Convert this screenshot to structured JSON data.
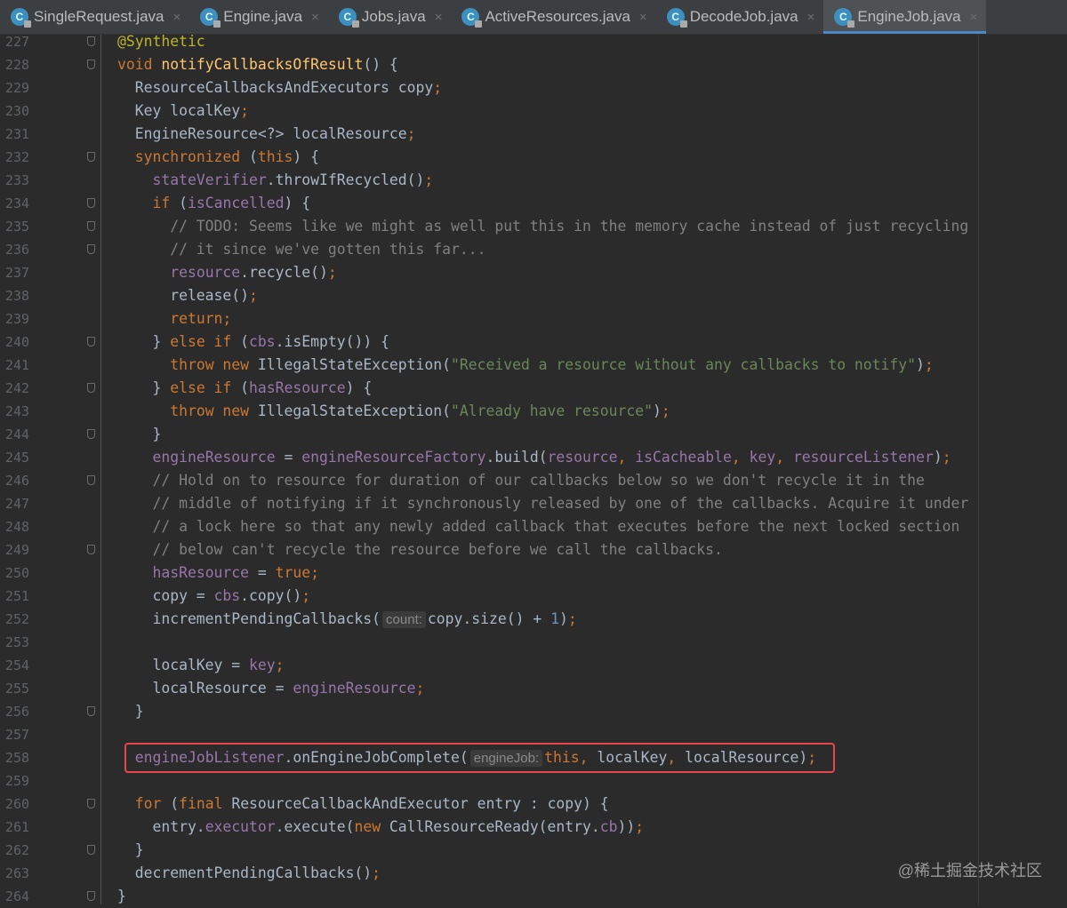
{
  "tabs": [
    {
      "label": "SingleRequest.java",
      "icon": "C",
      "active": false
    },
    {
      "label": "Engine.java",
      "icon": "C",
      "active": false
    },
    {
      "label": "Jobs.java",
      "icon": "C",
      "active": false
    },
    {
      "label": "ActiveResources.java",
      "icon": "C",
      "active": false
    },
    {
      "label": "DecodeJob.java",
      "icon": "C",
      "active": false
    },
    {
      "label": "EngineJob.java",
      "icon": "C",
      "active": true
    }
  ],
  "close_glyph": "×",
  "watermark": "@稀土掘金技术社区",
  "highlight_line": "258",
  "colors": {
    "keyword": "#cc7832",
    "field": "#9876aa",
    "method": "#ffc66d",
    "string": "#6a8759",
    "comment": "#808080",
    "number": "#6897bb",
    "annotation": "#bbb529",
    "highlight": "#e5484d"
  },
  "lines": [
    {
      "n": "227",
      "fold": true,
      "t": [
        [
          "@Synthetic",
          "a"
        ]
      ]
    },
    {
      "n": "228",
      "fold": true,
      "t": [
        [
          "void",
          "k"
        ],
        [
          " ",
          ""
        ],
        [
          "notifyCallbacksOfResult",
          "m"
        ],
        [
          "() {",
          ""
        ]
      ]
    },
    {
      "n": "229",
      "t": [
        [
          "  ResourceCallbacksAndExecutors copy",
          ""
        ],
        [
          ";",
          "k"
        ]
      ]
    },
    {
      "n": "230",
      "t": [
        [
          "  Key localKey",
          ""
        ],
        [
          ";",
          "k"
        ]
      ]
    },
    {
      "n": "231",
      "t": [
        [
          "  EngineResource<?> localResource",
          ""
        ],
        [
          ";",
          "k"
        ]
      ]
    },
    {
      "n": "232",
      "fold": true,
      "t": [
        [
          "  ",
          ""
        ],
        [
          "synchronized",
          "k"
        ],
        [
          " (",
          ""
        ],
        [
          "this",
          "k"
        ],
        [
          ") {",
          ""
        ]
      ]
    },
    {
      "n": "233",
      "t": [
        [
          "    ",
          ""
        ],
        [
          "stateVerifier",
          "f"
        ],
        [
          ".throwIfRecycled()",
          ""
        ],
        [
          ";",
          "k"
        ]
      ]
    },
    {
      "n": "234",
      "fold": true,
      "t": [
        [
          "    ",
          ""
        ],
        [
          "if",
          "k"
        ],
        [
          " (",
          ""
        ],
        [
          "isCancelled",
          "f"
        ],
        [
          ") {",
          ""
        ]
      ]
    },
    {
      "n": "235",
      "fold": true,
      "t": [
        [
          "      // TODO: Seems like we might as well put this in the memory cache instead of just recycling",
          "c"
        ]
      ]
    },
    {
      "n": "236",
      "fold": true,
      "t": [
        [
          "      // it since we've gotten this far...",
          "c"
        ]
      ]
    },
    {
      "n": "237",
      "t": [
        [
          "      ",
          ""
        ],
        [
          "resource",
          "f"
        ],
        [
          ".recycle()",
          ""
        ],
        [
          ";",
          "k"
        ]
      ]
    },
    {
      "n": "238",
      "t": [
        [
          "      release()",
          ""
        ],
        [
          ";",
          "k"
        ]
      ]
    },
    {
      "n": "239",
      "t": [
        [
          "      ",
          ""
        ],
        [
          "return;",
          "k"
        ]
      ]
    },
    {
      "n": "240",
      "fold": true,
      "t": [
        [
          "    } ",
          ""
        ],
        [
          "else if",
          "k"
        ],
        [
          " (",
          ""
        ],
        [
          "cbs",
          "f"
        ],
        [
          ".isEmpty()) {",
          ""
        ]
      ]
    },
    {
      "n": "241",
      "t": [
        [
          "      ",
          ""
        ],
        [
          "throw new",
          "k"
        ],
        [
          " IllegalStateException(",
          ""
        ],
        [
          "\"Received a resource without any callbacks to notify\"",
          "s"
        ],
        [
          ")",
          ""
        ],
        [
          ";",
          "k"
        ]
      ]
    },
    {
      "n": "242",
      "fold": true,
      "t": [
        [
          "    } ",
          ""
        ],
        [
          "else if",
          "k"
        ],
        [
          " (",
          ""
        ],
        [
          "hasResource",
          "f"
        ],
        [
          ") {",
          ""
        ]
      ]
    },
    {
      "n": "243",
      "t": [
        [
          "      ",
          ""
        ],
        [
          "throw new",
          "k"
        ],
        [
          " IllegalStateException(",
          ""
        ],
        [
          "\"Already have resource\"",
          "s"
        ],
        [
          ")",
          ""
        ],
        [
          ";",
          "k"
        ]
      ]
    },
    {
      "n": "244",
      "fold": true,
      "t": [
        [
          "    }",
          ""
        ]
      ]
    },
    {
      "n": "245",
      "t": [
        [
          "    ",
          ""
        ],
        [
          "engineResource",
          "f"
        ],
        [
          " = ",
          ""
        ],
        [
          "engineResourceFactory",
          "f"
        ],
        [
          ".build(",
          ""
        ],
        [
          "resource",
          "f"
        ],
        [
          ", ",
          "k"
        ],
        [
          "isCacheable",
          "f"
        ],
        [
          ", ",
          "k"
        ],
        [
          "key",
          "f"
        ],
        [
          ", ",
          "k"
        ],
        [
          "resourceListener",
          "f"
        ],
        [
          ")",
          ""
        ],
        [
          ";",
          "k"
        ]
      ]
    },
    {
      "n": "246",
      "fold": true,
      "t": [
        [
          "    // Hold on to resource for duration of our callbacks below so we don't recycle it in the",
          "c"
        ]
      ]
    },
    {
      "n": "247",
      "t": [
        [
          "    // middle of notifying if it synchronously released by one of the callbacks. Acquire it under",
          "c"
        ]
      ]
    },
    {
      "n": "248",
      "t": [
        [
          "    // a lock here so that any newly added callback that executes before the next locked section",
          "c"
        ]
      ]
    },
    {
      "n": "249",
      "fold": true,
      "t": [
        [
          "    // below can't recycle the resource before we call the callbacks.",
          "c"
        ]
      ]
    },
    {
      "n": "250",
      "t": [
        [
          "    ",
          ""
        ],
        [
          "hasResource",
          "f"
        ],
        [
          " = ",
          ""
        ],
        [
          "true",
          "k"
        ],
        [
          ";",
          "k"
        ]
      ]
    },
    {
      "n": "251",
      "t": [
        [
          "    copy = ",
          ""
        ],
        [
          "cbs",
          "f"
        ],
        [
          ".copy()",
          ""
        ],
        [
          ";",
          "k"
        ]
      ]
    },
    {
      "n": "252",
      "t": [
        [
          "    incrementPendingCallbacks(",
          ""
        ],
        [
          "count:",
          "h"
        ],
        [
          "copy.size() + ",
          ""
        ],
        [
          "1",
          "n"
        ],
        [
          ")",
          ""
        ],
        [
          ";",
          "k"
        ]
      ]
    },
    {
      "n": "253",
      "t": []
    },
    {
      "n": "254",
      "t": [
        [
          "    localKey = ",
          ""
        ],
        [
          "key",
          "f"
        ],
        [
          ";",
          "k"
        ]
      ]
    },
    {
      "n": "255",
      "t": [
        [
          "    localResource = ",
          ""
        ],
        [
          "engineResource",
          "f"
        ],
        [
          ";",
          "k"
        ]
      ]
    },
    {
      "n": "256",
      "fold": true,
      "t": [
        [
          "  }",
          ""
        ]
      ]
    },
    {
      "n": "257",
      "t": []
    },
    {
      "n": "258",
      "t": [
        [
          "  ",
          ""
        ],
        [
          "engineJobListener",
          "f"
        ],
        [
          ".onEngineJobComplete(",
          ""
        ],
        [
          "engineJob:",
          "h"
        ],
        [
          "this",
          "k"
        ],
        [
          ", ",
          "k"
        ],
        [
          "localKey",
          ""
        ],
        [
          ", ",
          "k"
        ],
        [
          "localResource)",
          ""
        ],
        [
          ";",
          "k"
        ]
      ]
    },
    {
      "n": "259",
      "t": []
    },
    {
      "n": "260",
      "fold": true,
      "t": [
        [
          "  ",
          ""
        ],
        [
          "for",
          "k"
        ],
        [
          " (",
          ""
        ],
        [
          "final",
          "k"
        ],
        [
          " ResourceCallbackAndExecutor entry : copy) {",
          ""
        ]
      ]
    },
    {
      "n": "261",
      "t": [
        [
          "    entry.",
          ""
        ],
        [
          "executor",
          "f"
        ],
        [
          ".execute(",
          ""
        ],
        [
          "new",
          "k"
        ],
        [
          " CallResourceReady(entry.",
          ""
        ],
        [
          "cb",
          "f"
        ],
        [
          "))",
          ""
        ],
        [
          ";",
          "k"
        ]
      ]
    },
    {
      "n": "262",
      "fold": true,
      "t": [
        [
          "  }",
          ""
        ]
      ]
    },
    {
      "n": "263",
      "t": [
        [
          "  decrementPendingCallbacks()",
          ""
        ],
        [
          ";",
          "k"
        ]
      ]
    },
    {
      "n": "264",
      "fold": true,
      "t": [
        [
          "}",
          ""
        ]
      ]
    }
  ]
}
